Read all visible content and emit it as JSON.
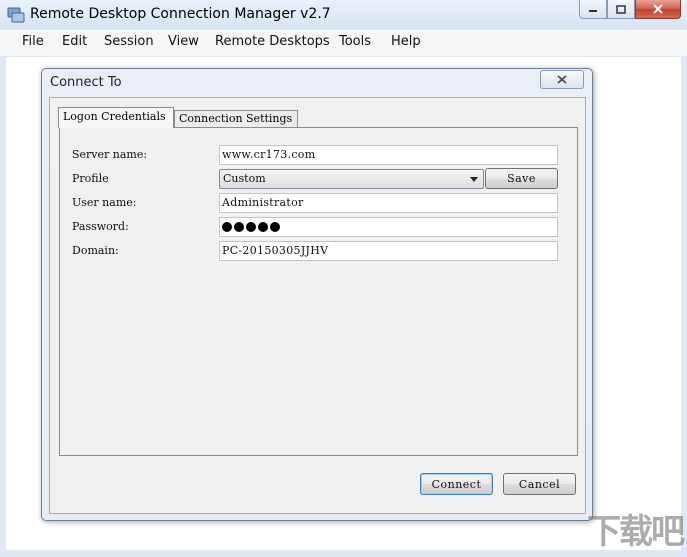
{
  "window": {
    "title": "Remote Desktop Connection Manager v2.7",
    "icon": "rdcman-app-icon"
  },
  "menu": {
    "items": [
      "File",
      "Edit",
      "Session",
      "View",
      "Remote Desktops",
      "Tools",
      "Help"
    ]
  },
  "dialog": {
    "title": "Connect To",
    "tabs": [
      {
        "label": "Logon Credentials",
        "active": true
      },
      {
        "label": "Connection Settings",
        "active": false
      }
    ],
    "fields": {
      "server_label": "Server name:",
      "server_value": "www.cr173.com",
      "profile_label": "Profile",
      "profile_value": "Custom",
      "save_label": "Save",
      "user_label": "User name:",
      "user_value": "Administrator",
      "password_label": "Password:",
      "password_mask_count": 5,
      "domain_label": "Domain:",
      "domain_value": "PC-20150305JJHV"
    },
    "buttons": {
      "connect": "Connect",
      "cancel": "Cancel"
    }
  },
  "watermark": {
    "text": "下载吧"
  }
}
